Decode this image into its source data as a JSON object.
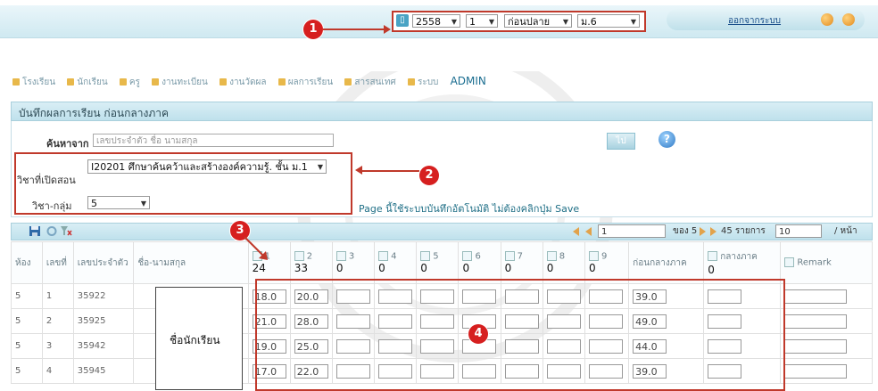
{
  "header": {
    "year": "2558",
    "term": "1",
    "period": "ก่อนปลาย",
    "grade": "ม.6",
    "logout": "ออกจากระบบ"
  },
  "badges": {
    "b1": "1",
    "b2": "2",
    "b3": "3",
    "b4": "4"
  },
  "nav": {
    "items": [
      "โรงเรียน",
      "นักเรียน",
      "ครู",
      "งานทะเบียน",
      "งานวัดผล",
      "ผลการเรียน",
      "สารสนเทศ",
      "ระบบ"
    ],
    "admin": "ADMIN"
  },
  "title": "บันทึกผลการเรียน ก่อนกลางภาค",
  "filters": {
    "search_label": "ค้นหาจาก",
    "search_placeholder": "เลขประจำตัว ชื่อ นามสกุล",
    "subject_label": "วิชาที่เปิดสอน",
    "subject_value": "I20201 ศึกษาค้นคว้าและสร้างองค์ความรู้. ชั้น ม.1",
    "group_label": "วิชา-กลุ่ม",
    "group_value": "5",
    "go_label": "ไป",
    "help_label": "?",
    "save_note": "Page นี้ใช้ระบบบันทึกอัตโนมัติ ไม่ต้องคลิกปุ่ม Save"
  },
  "pager": {
    "page": "1",
    "of_label": "ของ 5",
    "total_label": "45 รายการ",
    "per_page": "10",
    "per_page_suffix": "/ หน้า"
  },
  "table": {
    "headers": {
      "room": "ห้อง",
      "no": "เลขที่",
      "id": "เลขประจำตัว",
      "name": "ชื่อ-นามสกุล",
      "c1": "1",
      "c1v": "24",
      "c2": "2",
      "c2v": "33",
      "c3": "3",
      "c3v": "0",
      "c4": "4",
      "c4v": "0",
      "c5": "5",
      "c5v": "0",
      "c6": "6",
      "c6v": "0",
      "c7": "7",
      "c7v": "0",
      "c8": "8",
      "c8v": "0",
      "c9": "9",
      "c9v": "0",
      "pre": "ก่อนกลางภาค",
      "mid": "กลางภาค",
      "mid_v": "0",
      "remark": "Remark"
    },
    "rows": [
      {
        "room": "5",
        "no": "1",
        "id": "35922",
        "s1": "18.0",
        "s2": "20.0",
        "pre": "39.0"
      },
      {
        "room": "5",
        "no": "2",
        "id": "35925",
        "s1": "21.0",
        "s2": "28.0",
        "pre": "49.0"
      },
      {
        "room": "5",
        "no": "3",
        "id": "35942",
        "s1": "19.0",
        "s2": "25.0",
        "pre": "44.0"
      },
      {
        "room": "5",
        "no": "4",
        "id": "35945",
        "s1": "17.0",
        "s2": "22.0",
        "pre": "39.0"
      }
    ],
    "name_overlay": "ชื่อนักเรียน"
  },
  "colors": {
    "accent": "#c0392b",
    "header_bg": "#d9eef5",
    "badge": "#d61f1f"
  }
}
